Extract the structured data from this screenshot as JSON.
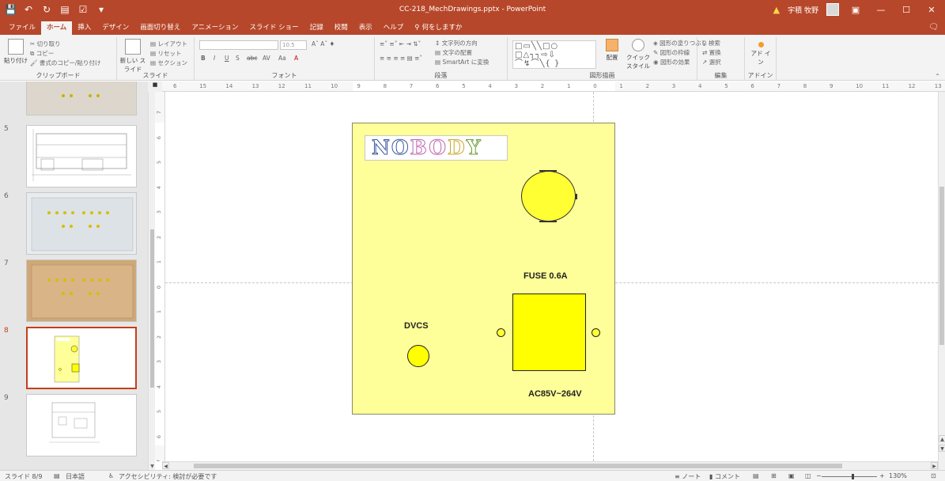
{
  "window": {
    "title": "CC-218_MechDrawings.pptx - PowerPoint",
    "user_name": "宇積 牧野",
    "qat_icons": [
      "save-icon",
      "undo-icon",
      "redo-icon",
      "start-from-beginning-icon",
      "spelling-icon",
      "customize-qat-icon"
    ],
    "controls": [
      "ribbon-display-icon",
      "minimize-icon",
      "maximize-icon",
      "close-icon"
    ]
  },
  "tabs": [
    {
      "label": "ファイル"
    },
    {
      "label": "ホーム",
      "active": true
    },
    {
      "label": "挿入"
    },
    {
      "label": "デザイン"
    },
    {
      "label": "画面切り替え"
    },
    {
      "label": "アニメーション"
    },
    {
      "label": "スライド ショー"
    },
    {
      "label": "記録"
    },
    {
      "label": "校閲"
    },
    {
      "label": "表示"
    },
    {
      "label": "ヘルプ"
    }
  ],
  "tell_me": "何をしますか",
  "ribbon": {
    "clipboard": {
      "label": "クリップボード",
      "paste": "貼り付け",
      "cut": "切り取り",
      "copy": "コピー",
      "format_painter": "書式のコピー/貼り付け"
    },
    "slides": {
      "label": "スライド",
      "new_slide": "新しい スライド",
      "layout": "レイアウト",
      "reset": "リセット",
      "section": "セクション"
    },
    "font": {
      "label": "フォント",
      "size": "10.5",
      "bold": "B",
      "italic": "I",
      "underline": "U",
      "shadow": "S",
      "strike": "abc",
      "spacing": "AV",
      "case": "Aa",
      "color": "A"
    },
    "paragraph": {
      "label": "段落",
      "text_direction": "文字列の方向",
      "align_text": "文字の配置",
      "smartart": "SmartArt に変換"
    },
    "drawing": {
      "label": "図形描画",
      "arrange": "配置",
      "quick_styles": "クイック スタイル",
      "shape_fill": "図形の塗りつぶし",
      "shape_outline": "図形の枠線",
      "shape_effects": "図形の効果",
      "shapes": "□▭╲╲□○\n□△┐┐⇨⇩\n⌒↯⌒╲{ }"
    },
    "editing": {
      "label": "編集",
      "find": "検索",
      "replace": "置換",
      "select": "選択"
    },
    "addins": {
      "label": "アドイン",
      "addins_button": "アド イン"
    }
  },
  "thumbnails": [
    {
      "num": "5"
    },
    {
      "num": "6"
    },
    {
      "num": "7"
    },
    {
      "num": "8",
      "selected": true
    },
    {
      "num": "9"
    }
  ],
  "ruler": {
    "h_ticks": [
      "6",
      "15",
      "14",
      "13",
      "12",
      "11",
      "10",
      "9",
      "8",
      "7",
      "6",
      "5",
      "4",
      "3",
      "2",
      "1",
      "0",
      "1",
      "2",
      "3",
      "4",
      "5",
      "6",
      "7",
      "8",
      "9",
      "10",
      "11",
      "12",
      "13"
    ],
    "v_ticks": [
      "7",
      "6",
      "5",
      "4",
      "3",
      "2",
      "1",
      "0",
      "1",
      "2",
      "3",
      "4",
      "5",
      "6",
      "7"
    ]
  },
  "slide": {
    "logo": [
      "N",
      "O",
      "B",
      "O",
      "D",
      "Y"
    ],
    "fuse_label": "FUSE 0.6A",
    "dc_label": "DVCS",
    "ac_label": "AC85V~264V",
    "background_color": "#ffff99",
    "part_color": "#ffff00"
  },
  "status": {
    "slide_pos": "スライド 8/9",
    "language": "日本語",
    "accessibility": "アクセシビリティ: 検討が必要です",
    "notes": "ノート",
    "comments": "コメント",
    "zoom": "130%"
  }
}
